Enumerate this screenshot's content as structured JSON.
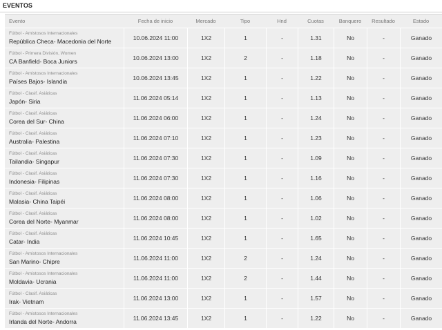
{
  "section": {
    "title": "EVENTOS"
  },
  "columns": {
    "event": "Evento",
    "start_date": "Fecha de inicio",
    "market": "Mercado",
    "type": "Tipo",
    "hnd": "Hnd",
    "odds": "Cuotas",
    "banker": "Banquero",
    "result": "Resultado",
    "status": "Estado"
  },
  "colors": {
    "status_won": "#3fb63f",
    "row_bg": "#eeeeee"
  },
  "rows": [
    {
      "competition": "Fútbol - Amistosos Internacionales",
      "match": "República Checa- Macedonia del Norte",
      "date": "10.06.2024 11:00",
      "market": "1X2",
      "type": "1",
      "hnd": "-",
      "odds": "1.31",
      "banker": "No",
      "result": "-",
      "status": "Ganado"
    },
    {
      "competition": "Fútbol - Primera División, Women",
      "match": "CA Banfield- Boca Juniors",
      "date": "10.06.2024 13:00",
      "market": "1X2",
      "type": "2",
      "hnd": "-",
      "odds": "1.18",
      "banker": "No",
      "result": "-",
      "status": "Ganado"
    },
    {
      "competition": "Fútbol - Amistosos Internacionales",
      "match": "Países Bajos- Islandia",
      "date": "10.06.2024 13:45",
      "market": "1X2",
      "type": "1",
      "hnd": "-",
      "odds": "1.22",
      "banker": "No",
      "result": "-",
      "status": "Ganado"
    },
    {
      "competition": "Fútbol - Clasif. Asiáticas",
      "match": "Japón- Siria",
      "date": "11.06.2024 05:14",
      "market": "1X2",
      "type": "1",
      "hnd": "-",
      "odds": "1.13",
      "banker": "No",
      "result": "-",
      "status": "Ganado"
    },
    {
      "competition": "Fútbol - Clasif. Asiáticas",
      "match": "Corea del Sur- China",
      "date": "11.06.2024 06:00",
      "market": "1X2",
      "type": "1",
      "hnd": "-",
      "odds": "1.24",
      "banker": "No",
      "result": "-",
      "status": "Ganado"
    },
    {
      "competition": "Fútbol - Clasif. Asiáticas",
      "match": "Australia- Palestina",
      "date": "11.06.2024 07:10",
      "market": "1X2",
      "type": "1",
      "hnd": "-",
      "odds": "1.23",
      "banker": "No",
      "result": "-",
      "status": "Ganado"
    },
    {
      "competition": "Fútbol - Clasif. Asiáticas",
      "match": "Tailandia- Singapur",
      "date": "11.06.2024 07:30",
      "market": "1X2",
      "type": "1",
      "hnd": "-",
      "odds": "1.09",
      "banker": "No",
      "result": "-",
      "status": "Ganado"
    },
    {
      "competition": "Fútbol - Clasif. Asiáticas",
      "match": "Indonesia- Filipinas",
      "date": "11.06.2024 07:30",
      "market": "1X2",
      "type": "1",
      "hnd": "-",
      "odds": "1.16",
      "banker": "No",
      "result": "-",
      "status": "Ganado"
    },
    {
      "competition": "Fútbol - Clasif. Asiáticas",
      "match": "Malasia- China Taipéi",
      "date": "11.06.2024 08:00",
      "market": "1X2",
      "type": "1",
      "hnd": "-",
      "odds": "1.06",
      "banker": "No",
      "result": "-",
      "status": "Ganado"
    },
    {
      "competition": "Fútbol - Clasif. Asiáticas",
      "match": "Corea del Norte- Myanmar",
      "date": "11.06.2024 08:00",
      "market": "1X2",
      "type": "1",
      "hnd": "-",
      "odds": "1.02",
      "banker": "No",
      "result": "-",
      "status": "Ganado"
    },
    {
      "competition": "Fútbol - Clasif. Asiáticas",
      "match": "Catar- India",
      "date": "11.06.2024 10:45",
      "market": "1X2",
      "type": "1",
      "hnd": "-",
      "odds": "1.65",
      "banker": "No",
      "result": "-",
      "status": "Ganado"
    },
    {
      "competition": "Fútbol - Amistosos Internacionales",
      "match": "San Marino- Chipre",
      "date": "11.06.2024 11:00",
      "market": "1X2",
      "type": "2",
      "hnd": "-",
      "odds": "1.24",
      "banker": "No",
      "result": "-",
      "status": "Ganado"
    },
    {
      "competition": "Fútbol - Amistosos Internacionales",
      "match": "Moldavia- Ucrania",
      "date": "11.06.2024 11:00",
      "market": "1X2",
      "type": "2",
      "hnd": "-",
      "odds": "1.44",
      "banker": "No",
      "result": "-",
      "status": "Ganado"
    },
    {
      "competition": "Fútbol - Clasif. Asiáticas",
      "match": "Irak- Vietnam",
      "date": "11.06.2024 13:00",
      "market": "1X2",
      "type": "1",
      "hnd": "-",
      "odds": "1.57",
      "banker": "No",
      "result": "-",
      "status": "Ganado"
    },
    {
      "competition": "Fútbol - Amistosos Internacionales",
      "match": "Irlanda del Norte- Andorra",
      "date": "11.06.2024 13:45",
      "market": "1X2",
      "type": "1",
      "hnd": "-",
      "odds": "1.22",
      "banker": "No",
      "result": "-",
      "status": "Ganado"
    }
  ]
}
